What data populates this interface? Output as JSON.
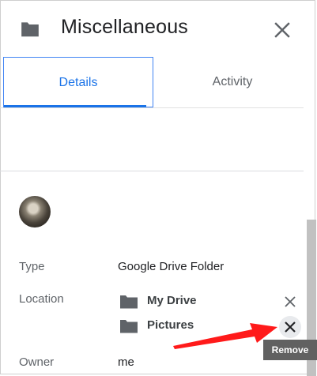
{
  "header": {
    "title": "Miscellaneous",
    "folder_icon": "folder-icon",
    "close_icon": "close-icon"
  },
  "tabs": [
    {
      "label": "Details",
      "selected": true
    },
    {
      "label": "Activity",
      "selected": false
    }
  ],
  "details": {
    "avatar_icon": "avatar",
    "type_label": "Type",
    "type_value": "Google Drive Folder",
    "location_label": "Location",
    "locations": [
      {
        "name": "My Drive",
        "icon": "folder-icon",
        "remove_icon": "close-icon"
      },
      {
        "name": "Pictures",
        "icon": "folder-icon",
        "remove_icon": "close-icon"
      }
    ],
    "owner_label": "Owner",
    "owner_value": "me"
  },
  "tooltip": {
    "text": "Remove"
  },
  "annotation": {
    "icon": "red-arrow",
    "color": "#ff1a1a"
  },
  "colors": {
    "accent": "#1a73e8",
    "icon_gray": "#5f6368",
    "tooltip_bg": "#616161"
  }
}
